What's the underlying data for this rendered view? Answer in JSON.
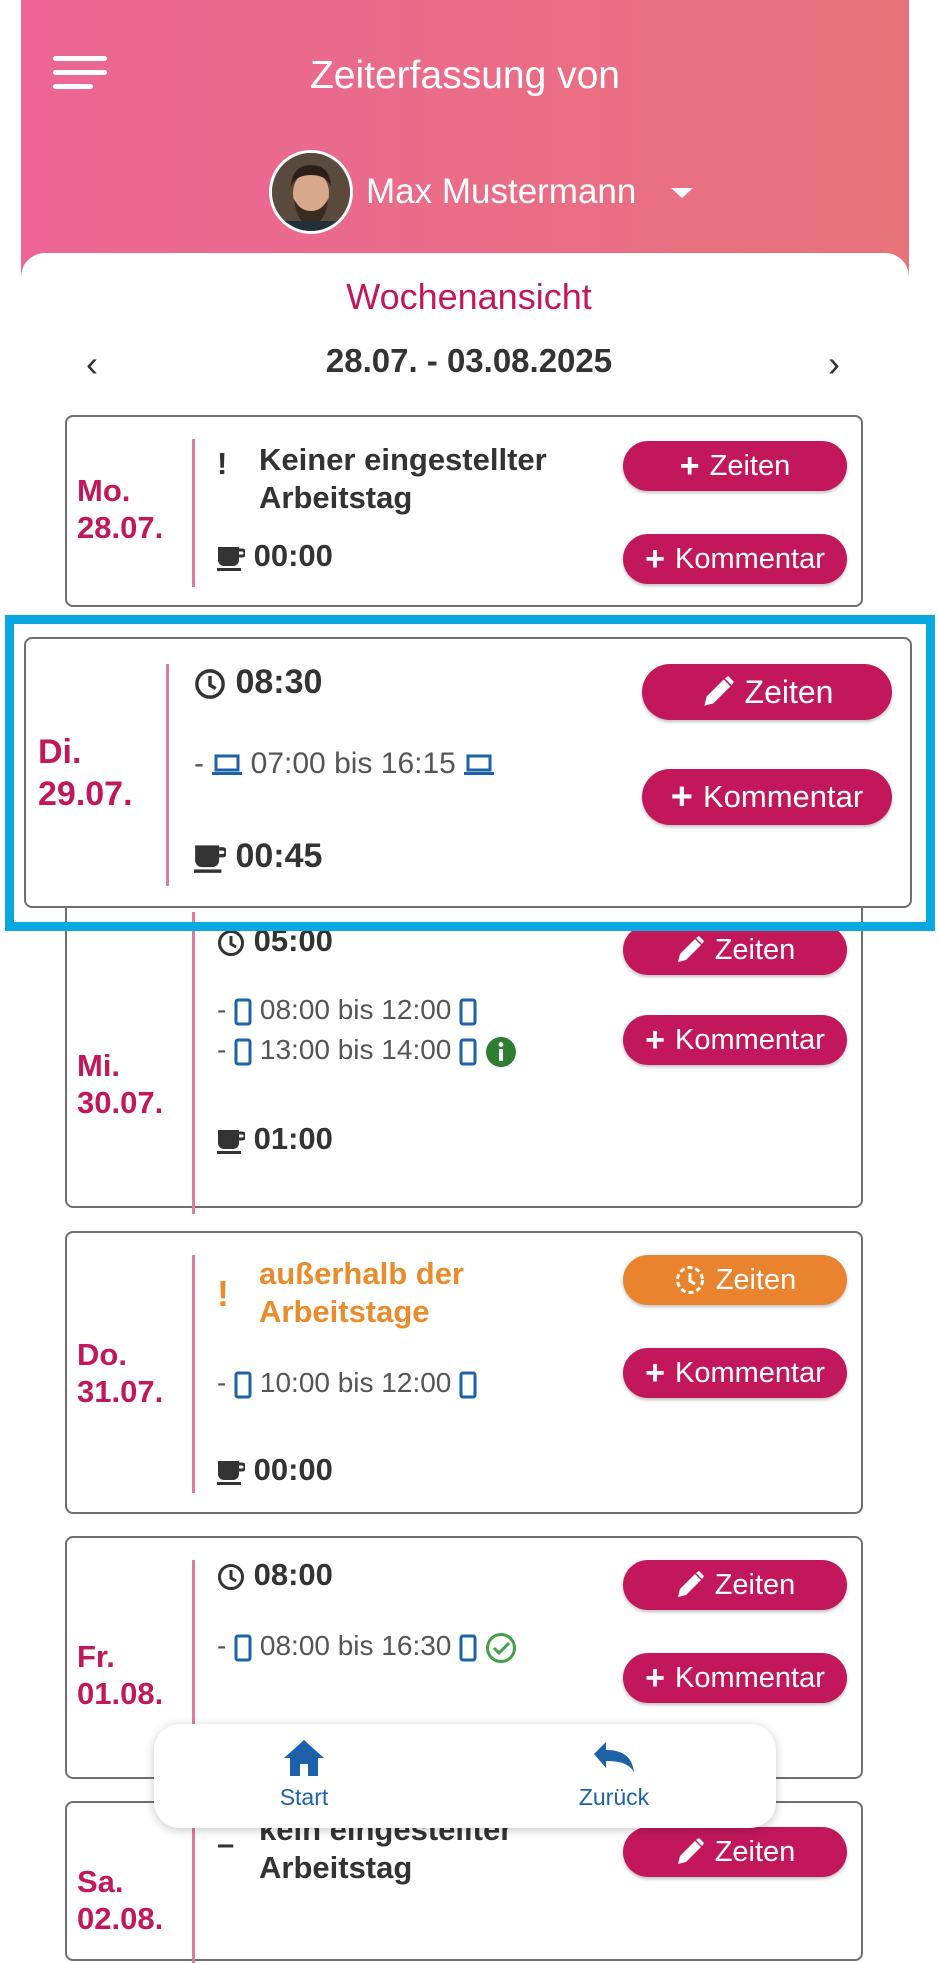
{
  "header": {
    "title": "Zeiterfassung von",
    "user_name": "Max Mustermann"
  },
  "week": {
    "title": "Wochenansicht",
    "range": "28.07. - 03.08.2025",
    "prev": "‹",
    "next": "›"
  },
  "buttons": {
    "zeiten": "Zeiten",
    "kommentar": "Kommentar"
  },
  "days": [
    {
      "weekday": "Mo.",
      "date": "28.07.",
      "status": "Keiner eingestellter Arbeitstag",
      "status_line1": "Keiner eingestellter",
      "status_line2": "Arbeitstag",
      "pause": "00:00"
    },
    {
      "weekday": "Di.",
      "date": "29.07.",
      "worked": "08:30",
      "entries": [
        {
          "from": "07:00",
          "to": "16:15",
          "text": "07:00 bis 16:15"
        }
      ],
      "pause": "00:45"
    },
    {
      "weekday": "Mi.",
      "date": "30.07.",
      "worked": "05:00",
      "entries": [
        {
          "from": "08:00",
          "to": "12:00",
          "text": "08:00 bis 12:00"
        },
        {
          "from": "13:00",
          "to": "14:00",
          "text": "13:00 bis 14:00"
        }
      ],
      "pause": "01:00"
    },
    {
      "weekday": "Do.",
      "date": "31.07.",
      "status_line1": "außerhalb der",
      "status_line2": "Arbeitstage",
      "entries": [
        {
          "from": "10:00",
          "to": "12:00",
          "text": "10:00 bis 12:00"
        }
      ],
      "pause": "00:00"
    },
    {
      "weekday": "Fr.",
      "date": "01.08.",
      "worked": "08:00",
      "entries": [
        {
          "from": "08:00",
          "to": "16:30",
          "text": "08:00 bis 16:30"
        }
      ]
    },
    {
      "weekday": "Sa.",
      "date": "02.08.",
      "status_line1": "kein eingestellter",
      "status_line2": "Arbeitstag"
    }
  ],
  "bottom_nav": {
    "start": "Start",
    "back": "Zurück"
  },
  "colors": {
    "primary": "#c2185b",
    "warning": "#e9832e",
    "highlight": "#0aa8e0",
    "icon_blue": "#1d62a8"
  }
}
